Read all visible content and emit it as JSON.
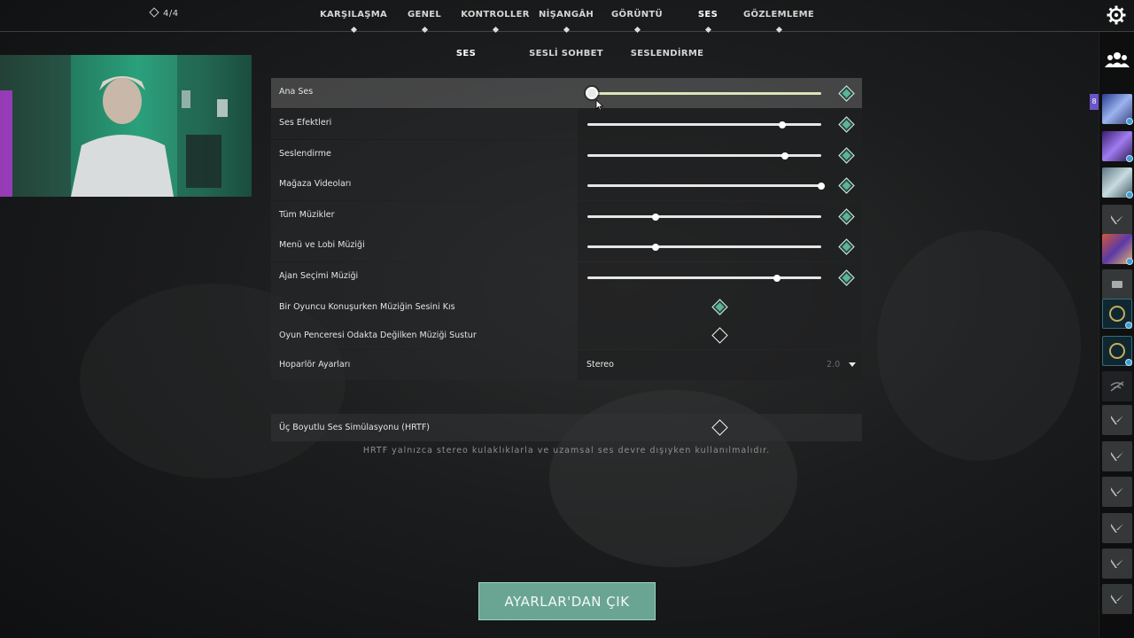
{
  "topbar": {
    "counter": "4/4",
    "tabs": [
      {
        "label": "KARŞILAŞMA",
        "active": false
      },
      {
        "label": "GENEL",
        "active": false
      },
      {
        "label": "KONTROLLER",
        "active": false
      },
      {
        "label": "NİŞANGÂH",
        "active": false
      },
      {
        "label": "GÖRÜNTÜ",
        "active": false
      },
      {
        "label": "SES",
        "active": true
      },
      {
        "label": "GÖZLEMLEME",
        "active": false
      }
    ],
    "settings_icon": "gear-icon"
  },
  "subtabs": [
    {
      "label": "SES",
      "active": true
    },
    {
      "label": "SESLİ SOHBET",
      "active": false
    },
    {
      "label": "SESLENDİRME",
      "active": false
    }
  ],
  "sliders": [
    {
      "label": "Ana Ses",
      "value": 0.02,
      "toggle": "on",
      "highlighted": true
    },
    {
      "label": "Ses Efektleri",
      "value": 0.835,
      "toggle": "on"
    },
    {
      "label": "Seslendirme",
      "value": 0.845,
      "toggle": "on"
    },
    {
      "label": "Mağaza Videoları",
      "value": 1.0,
      "toggle": "on"
    },
    {
      "label": "Tüm Müzikler",
      "value": 0.29,
      "toggle": "on"
    },
    {
      "label": "Menü ve Lobi Müziği",
      "value": 0.29,
      "toggle": "on"
    },
    {
      "label": "Ajan Seçimi Müziği",
      "value": 0.81,
      "toggle": "on"
    }
  ],
  "toggles": [
    {
      "label": "Bir Oyuncu Konuşurken Müziğin Sesini Kıs",
      "state": "on"
    },
    {
      "label": "Oyun Penceresi Odakta Değilken Müziği Sustur",
      "state": "off"
    }
  ],
  "speaker": {
    "label": "Hoparlör Ayarları",
    "value": "Stereo",
    "sub": "2.0"
  },
  "hrtf": {
    "label": "Üç Boyutlu Ses Simülasyonu (HRTF)",
    "state": "off",
    "note": "HRTF yalnızca stereo kulaklıklarla ve uzamsal ses devre dışıyken kullanılmalıdır."
  },
  "exit_button": "AYARLAR'DAN ÇIK",
  "sidebar": {
    "party_count": "8"
  },
  "colors": {
    "accent": "#6aa594",
    "toggle_on": "#5db39a",
    "slider_active": "#dbe4b8"
  }
}
